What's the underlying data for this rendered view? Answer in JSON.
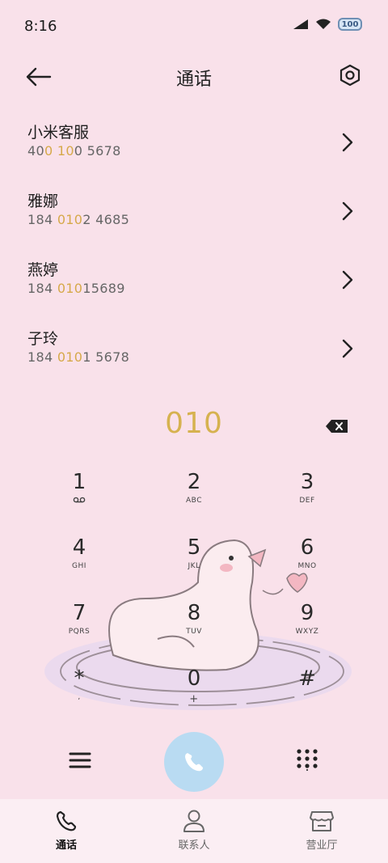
{
  "status_bar": {
    "time": "8:16",
    "battery": "100"
  },
  "header": {
    "title": "通话"
  },
  "results": [
    {
      "name": "小米客服",
      "number_parts": [
        "40",
        "0 10",
        "0 5678"
      ]
    },
    {
      "name": "雅娜",
      "number_parts": [
        "184 ",
        "010",
        "2 4685"
      ]
    },
    {
      "name": "燕婷",
      "number_parts": [
        "184 ",
        "010",
        "15689"
      ]
    },
    {
      "name": "子玲",
      "number_parts": [
        "184 ",
        "010",
        "1 5678"
      ]
    }
  ],
  "dial_input": "010",
  "keypad": [
    {
      "digit": "1",
      "sub": ""
    },
    {
      "digit": "2",
      "sub": "ABC"
    },
    {
      "digit": "3",
      "sub": "DEF"
    },
    {
      "digit": "4",
      "sub": "GHI"
    },
    {
      "digit": "5",
      "sub": "JKL"
    },
    {
      "digit": "6",
      "sub": "MNO"
    },
    {
      "digit": "7",
      "sub": "PQRS"
    },
    {
      "digit": "8",
      "sub": "TUV"
    },
    {
      "digit": "9",
      "sub": "WXYZ"
    },
    {
      "digit": "*",
      "sub": ","
    },
    {
      "digit": "0",
      "sub": "+"
    },
    {
      "digit": "#",
      "sub": ""
    }
  ],
  "bottom_nav": [
    {
      "label": "通话",
      "icon": "phone-icon",
      "active": true
    },
    {
      "label": "联系人",
      "icon": "person-icon",
      "active": false
    },
    {
      "label": "营业厅",
      "icon": "store-icon",
      "active": false
    }
  ],
  "colors": {
    "background": "#f9e1ea",
    "highlight": "#d6b24f",
    "call_button": "#b9dbf2"
  }
}
